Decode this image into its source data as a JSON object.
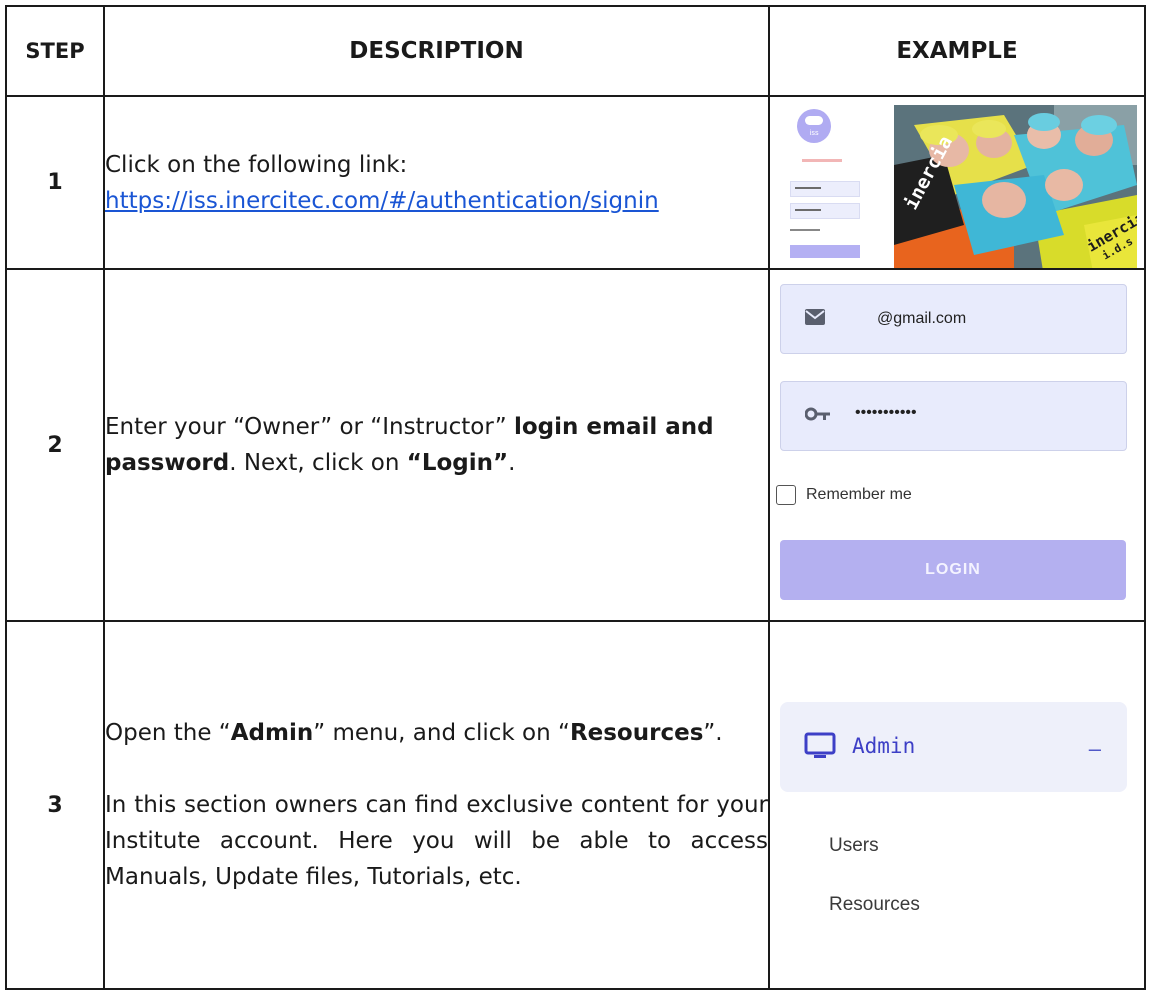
{
  "table": {
    "headers": {
      "step": "STEP",
      "description": "DESCRIPTION",
      "example": "EXAMPLE"
    },
    "rows": [
      {
        "step": "1",
        "text_before_link": "Click on the following link:",
        "link": "https://iss.inercitec.com/#/authentication/signin"
      },
      {
        "step": "2",
        "parts": [
          "Enter your “Owner” or “Instructor” ",
          "login email and password",
          ". Next, click on ",
          "“Login”",
          "."
        ]
      },
      {
        "step": "3",
        "para1": [
          "Open the “",
          "Admin",
          "” menu, and click on “",
          "Resources",
          "”."
        ],
        "para2": "In this section owners can find exclusive content for your Institute account. Here you will be able to access Manuals, Update files, Tutorials, etc."
      }
    ]
  },
  "example1": {
    "logo_text": "iss",
    "photo_caption_left": "inercia",
    "photo_caption_right": "inercia",
    "photo_caption_sub": "i.d.s"
  },
  "example2": {
    "email_value": "@gmail.com",
    "password_value": "•••••••••••",
    "remember_label": "Remember me",
    "login_button": "LOGIN",
    "icons": {
      "email": "envelope-icon",
      "password": "key-icon"
    },
    "accent": "#b4b0f0"
  },
  "example3": {
    "menu_label": "Admin",
    "collapse_symbol": "–",
    "items": [
      "Users",
      "Resources"
    ],
    "icons": {
      "menu": "monitor-icon"
    },
    "accent": "#3d3fc6"
  }
}
